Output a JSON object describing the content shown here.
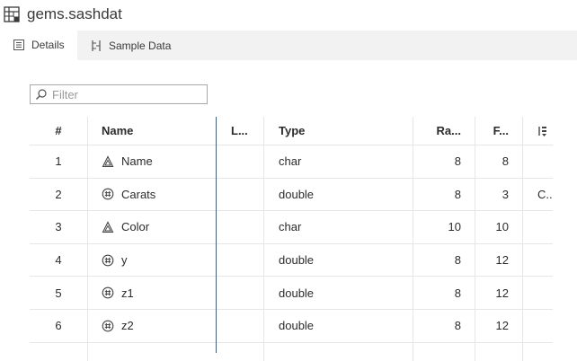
{
  "window": {
    "title": "gems.sashdat"
  },
  "tabs": [
    {
      "label": "Details",
      "active": true
    },
    {
      "label": "Sample Data",
      "active": false
    }
  ],
  "filter": {
    "placeholder": "Filter",
    "value": ""
  },
  "table": {
    "headers": {
      "num": "#",
      "name": "Name",
      "label": "L...",
      "type": "Type",
      "raw": "Ra...",
      "format": "F..."
    },
    "rows": [
      {
        "num": "1",
        "icon": "character-icon",
        "name": "Name",
        "label": "",
        "type": "char",
        "raw": "8",
        "format": "8",
        "ext": ""
      },
      {
        "num": "2",
        "icon": "numeric-icon",
        "name": "Carats",
        "label": "",
        "type": "double",
        "raw": "8",
        "format": "3",
        "ext": "C..."
      },
      {
        "num": "3",
        "icon": "character-icon",
        "name": "Color",
        "label": "",
        "type": "char",
        "raw": "10",
        "format": "10",
        "ext": ""
      },
      {
        "num": "4",
        "icon": "numeric-icon",
        "name": "y",
        "label": "",
        "type": "double",
        "raw": "8",
        "format": "12",
        "ext": ""
      },
      {
        "num": "5",
        "icon": "numeric-icon",
        "name": "z1",
        "label": "",
        "type": "double",
        "raw": "8",
        "format": "12",
        "ext": ""
      },
      {
        "num": "6",
        "icon": "numeric-icon",
        "name": "z2",
        "label": "",
        "type": "double",
        "raw": "8",
        "format": "12",
        "ext": ""
      }
    ]
  },
  "colors": {
    "accent_divider": "#44617b",
    "tabbar_bg": "#f2f2f2",
    "border": "#a9a9a9"
  }
}
